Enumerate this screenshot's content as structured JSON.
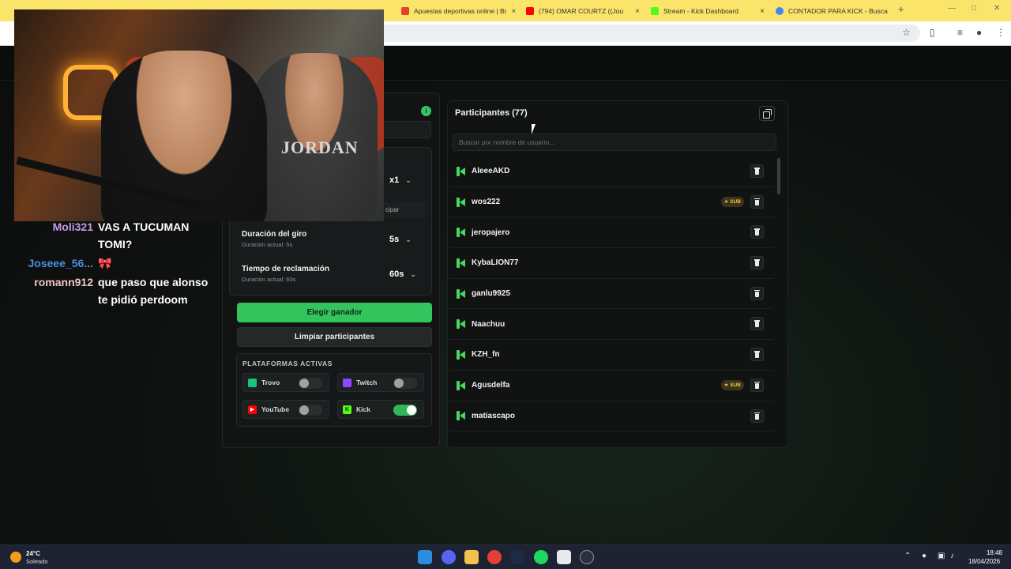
{
  "browser": {
    "tabs": [
      {
        "label": "Apuestas deportivas online | Br",
        "favicon_color": "#e0442b"
      },
      {
        "label": "(794) OMAR COURTZ ((Jou",
        "favicon_color": "#ff0000"
      },
      {
        "label": "Stream - Kick Dashboard",
        "favicon_color": "#53fc18"
      },
      {
        "label": "CONTADOR PARA KICK - Busca",
        "favicon_color": "#4285f4"
      }
    ],
    "new_tab": "+",
    "close_glyph": "×"
  },
  "chat": [
    {
      "user": "Moli321",
      "color": "#c79be8",
      "message": "VAS A TUCUMAN TOMI?"
    },
    {
      "user": "Joseee_56...",
      "color": "#4a8fe0",
      "message": "🎀"
    },
    {
      "user": "romann912",
      "color": "#f0c7c7",
      "message": "que paso que alonso te pidió perdoom"
    }
  ],
  "settings": {
    "status_badge": "i",
    "multiplier": "x1",
    "partial_label": "cipar",
    "spin_duration": {
      "title": "Duración del giro",
      "subtitle": "Duración actual: 5s",
      "value": "5s"
    },
    "claim_time": {
      "title": "Tiempo de reclamación",
      "subtitle": "Duración actual: 60s",
      "value": "60s"
    },
    "pick_winner": "Elegir ganador",
    "clear_participants": "Limpiar participantes",
    "platforms_title": "PLATAFORMAS ACTIVAS",
    "platforms": [
      {
        "name": "Trovo",
        "color": "#1bc47d",
        "enabled": false
      },
      {
        "name": "Twitch",
        "color": "#9146ff",
        "enabled": false
      },
      {
        "name": "YouTube",
        "color": "#ff0000",
        "enabled": false
      },
      {
        "name": "Kick",
        "color": "#53fc18",
        "enabled": true
      }
    ]
  },
  "participants": {
    "title": "Participantes (77)",
    "search_placeholder": "Buscar por nombre de usuario...",
    "sub_badge": "★ SUB",
    "users": [
      {
        "name": "AleeeAKD",
        "sub": false
      },
      {
        "name": "wos222",
        "sub": true
      },
      {
        "name": "jeropajero",
        "sub": false
      },
      {
        "name": "KybaLION77",
        "sub": false
      },
      {
        "name": "ganlu9925",
        "sub": false
      },
      {
        "name": "Naachuu",
        "sub": false
      },
      {
        "name": "KZH_fn",
        "sub": false
      },
      {
        "name": "Agusdelfa",
        "sub": true
      },
      {
        "name": "matiascapo",
        "sub": false
      }
    ]
  },
  "webcam": {
    "shirt_text": "JORDAN"
  },
  "taskbar": {
    "temperature": "24°C",
    "weather": "Soleado",
    "time": "18:48",
    "date": "18/04/2026"
  }
}
